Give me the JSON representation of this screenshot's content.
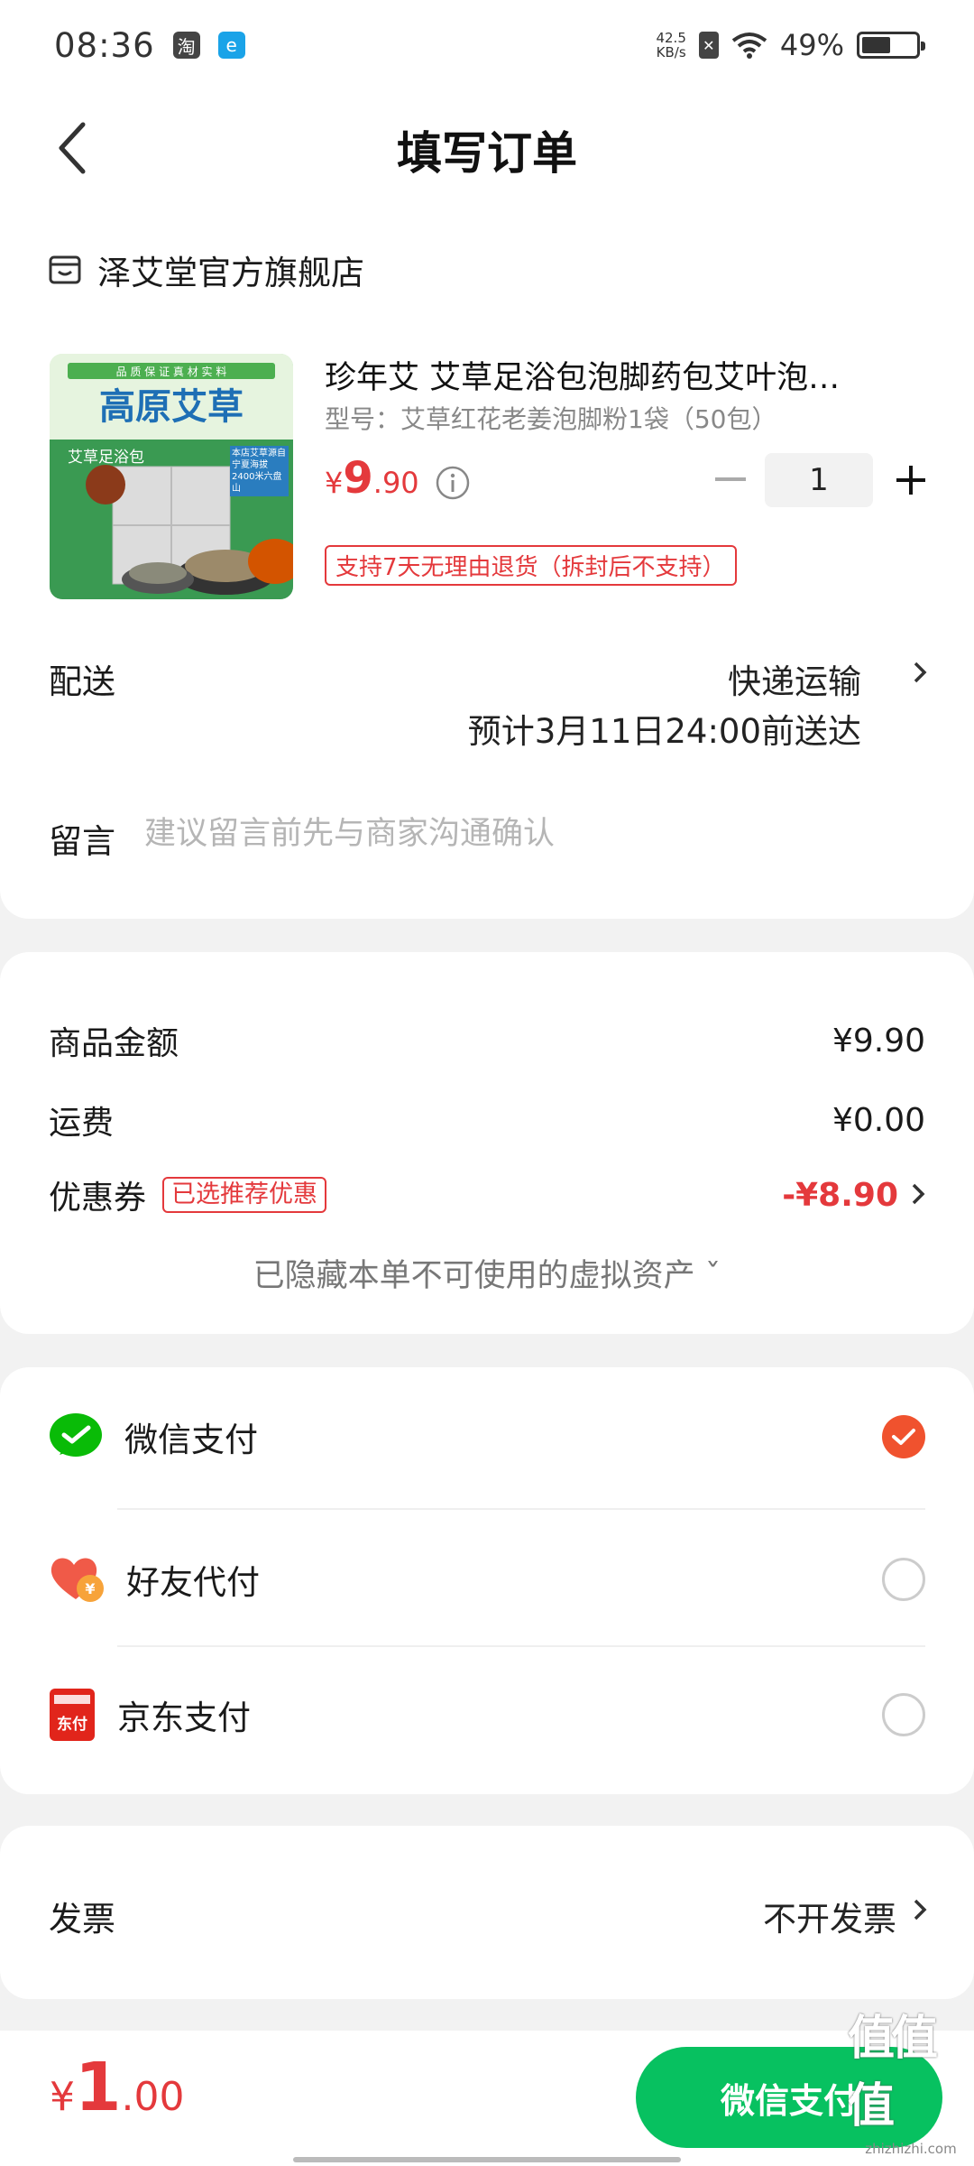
{
  "status_bar": {
    "time": "08:36",
    "taobao_glyph": "淘",
    "eapp_glyph": "e",
    "net_speed_value": "42.5",
    "net_speed_unit": "KB/s",
    "battery_text": "49%"
  },
  "header": {
    "title": "填写订单"
  },
  "shop": {
    "name": "泽艾堂官方旗舰店"
  },
  "product": {
    "title": "珍年艾 艾草足浴包泡脚药包艾叶泡…",
    "spec": "型号：艾草红花老姜泡脚粉1袋（50包）",
    "price_symbol": "¥",
    "price_int": "9",
    "price_dec": ".90",
    "quantity": "1",
    "return_policy": "支持7天无理由退货（拆封后不支持）",
    "image": {
      "banner": "品 质 保 证 真 材 实 料",
      "headline": "高原艾草",
      "sub": "艾草足浴包",
      "side_note": "本店艾草源自宁夏海拔2400米六盘山"
    }
  },
  "delivery": {
    "label": "配送",
    "method": "快递运输",
    "eta": "预计3月11日24:00前送达"
  },
  "message": {
    "label": "留言",
    "placeholder": "建议留言前先与商家沟通确认"
  },
  "summary": {
    "goods_label": "商品金额",
    "goods_value": "¥9.90",
    "shipping_label": "运费",
    "shipping_value": "¥0.00",
    "coupon_label": "优惠券",
    "coupon_badge": "已选推荐优惠",
    "coupon_value": "-¥8.90",
    "hidden_assets": "已隐藏本单不可使用的虚拟资产 ˇ"
  },
  "payment": {
    "options": [
      {
        "label": "微信支付",
        "selected": true
      },
      {
        "label": "好友代付",
        "selected": false
      },
      {
        "label": "京东支付",
        "selected": false
      }
    ],
    "jd_icon_text": "东付"
  },
  "invoice": {
    "label": "发票",
    "value": "不开发票"
  },
  "bottom": {
    "total_symbol": "¥",
    "total_int": "1",
    "total_dec": ".00",
    "pay_button": "微信支付"
  },
  "watermark": {
    "main": "值值值",
    "sub": "zhizhizhi.com"
  },
  "colors": {
    "accent_red": "#e4393c",
    "wechat_green": "#07c160",
    "radio_orange": "#f0522e"
  }
}
